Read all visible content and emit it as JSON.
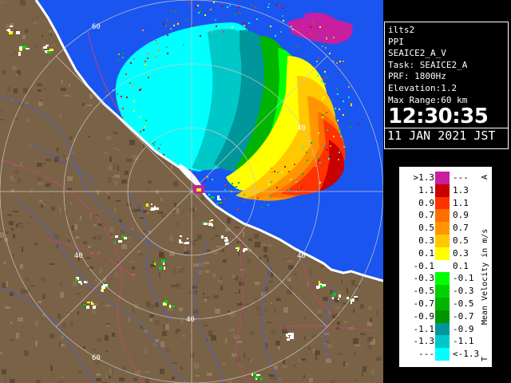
{
  "map": {
    "range_ring_labels": [
      "60",
      "40",
      "40",
      "40",
      "40",
      "60"
    ],
    "colors": {
      "land": "#7a6246",
      "sea_no_echo": "#1a55f0",
      "coast": "#ffffff",
      "rivers": "#4a62c8",
      "boundaries": "#b84a70",
      "range_rings": "#c8c8c8",
      "info_panel_background": "#000000",
      "legend_background": "#ffffff"
    }
  },
  "info": {
    "radar_name": "ilts2",
    "scan_type": "PPI",
    "volume_name": "SEAICE2_A_V",
    "task": "Task: SEAICE2_A",
    "prf": "PRF: 1800Hz",
    "elevation": "Elevation:1.2",
    "max_range": "Max Range:60 km",
    "time": "12:30:35",
    "date": "11 JAN 2021 JST"
  },
  "legend": {
    "title": "Mean Velocity in m/s",
    "top_marker": "A",
    "bottom_marker": "T",
    "rows": [
      {
        "low": ">1.3",
        "high": "---",
        "color": "#c81ea0"
      },
      {
        "low": "1.1",
        "high": "1.3",
        "color": "#c80000"
      },
      {
        "low": "0.9",
        "high": "1.1",
        "color": "#ff3200"
      },
      {
        "low": "0.7",
        "high": "0.9",
        "color": "#ff6e00"
      },
      {
        "low": "0.5",
        "high": "0.7",
        "color": "#ff9600"
      },
      {
        "low": "0.3",
        "high": "0.5",
        "color": "#ffc800"
      },
      {
        "low": "0.1",
        "high": "0.3",
        "color": "#ffff00"
      },
      {
        "low": "-0.1",
        "high": "0.1",
        "color": "#ffffff"
      },
      {
        "low": "-0.3",
        "high": "-0.1",
        "color": "#00ff00"
      },
      {
        "low": "-0.5",
        "high": "-0.3",
        "color": "#00d200"
      },
      {
        "low": "-0.7",
        "high": "-0.5",
        "color": "#00b400"
      },
      {
        "low": "-0.9",
        "high": "-0.7",
        "color": "#009600"
      },
      {
        "low": "-1.1",
        "high": "-0.9",
        "color": "#00969b"
      },
      {
        "low": "-1.3",
        "high": "-1.1",
        "color": "#00c8c8"
      },
      {
        "low": "---",
        "high": "<-1.3",
        "color": "#00ffff"
      }
    ]
  }
}
